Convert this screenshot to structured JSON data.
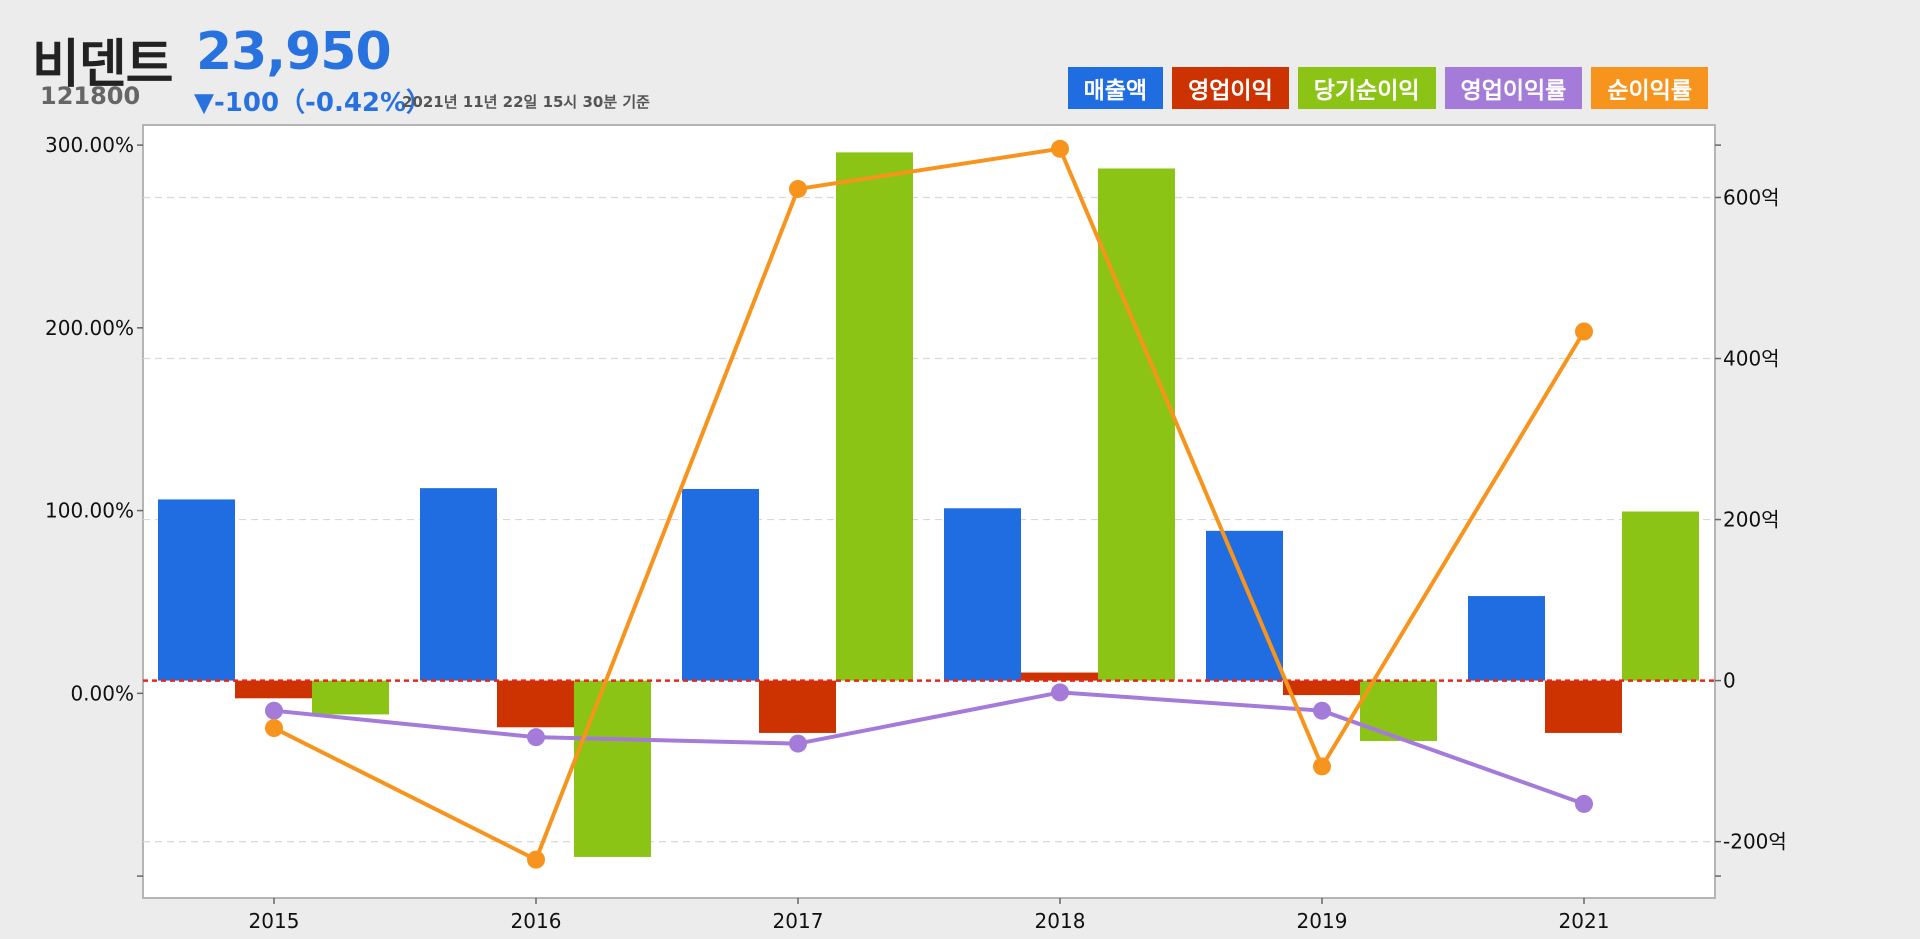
{
  "stock": {
    "name": "비덴트",
    "price": "23,950",
    "code": "121800",
    "change": "▼-100（-0.42%）",
    "timestamp": "2021년 11년 22일 15시 30분 기준"
  },
  "legend": [
    {
      "label": "매출액",
      "color": "#1f6de0"
    },
    {
      "label": "영업이익",
      "color": "#cc3300"
    },
    {
      "label": "당기순이익",
      "color": "#8bc414"
    },
    {
      "label": "영업이익률",
      "color": "#a57bd9"
    },
    {
      "label": "순이익률",
      "color": "#f7941d"
    }
  ],
  "chart_data": {
    "type": "bar",
    "categories": [
      "2015",
      "2016",
      "2017",
      "2018",
      "2019",
      "2021"
    ],
    "bar_series": [
      {
        "name": "매출액",
        "color": "#1f6de0",
        "values": [
          225,
          239,
          238,
          214,
          186,
          105
        ]
      },
      {
        "name": "영업이익",
        "color": "#cc3300",
        "values": [
          -22,
          -58,
          -65,
          10,
          -18,
          -65
        ]
      },
      {
        "name": "당기순이익",
        "color": "#8bc414",
        "values": [
          -42,
          -219,
          656,
          636,
          -75,
          210
        ]
      }
    ],
    "line_series": [
      {
        "name": "영업이익률",
        "color": "#a57bd9",
        "values": [
          -9.5,
          -24,
          -27.5,
          0.5,
          -9.5,
          -60.5
        ]
      },
      {
        "name": "순이익률",
        "color": "#f7941d",
        "values": [
          -19,
          -91,
          276,
          298,
          -40,
          198
        ]
      }
    ],
    "left_axis": {
      "ticks": [
        {
          "value": 300,
          "label": "300.00%"
        },
        {
          "value": 200,
          "label": "200.00%"
        },
        {
          "value": 100,
          "label": "100.00%"
        },
        {
          "value": 0,
          "label": "0.00%"
        }
      ],
      "range": [
        -112,
        311
      ]
    },
    "right_axis": {
      "ticks": [
        {
          "value": 600,
          "label": "600억"
        },
        {
          "value": 400,
          "label": "400억"
        },
        {
          "value": 200,
          "label": "200억"
        },
        {
          "value": 0,
          "label": "0"
        },
        {
          "value": -200,
          "label": "-200억"
        }
      ],
      "range": [
        -270,
        690
      ]
    },
    "grid": true
  }
}
